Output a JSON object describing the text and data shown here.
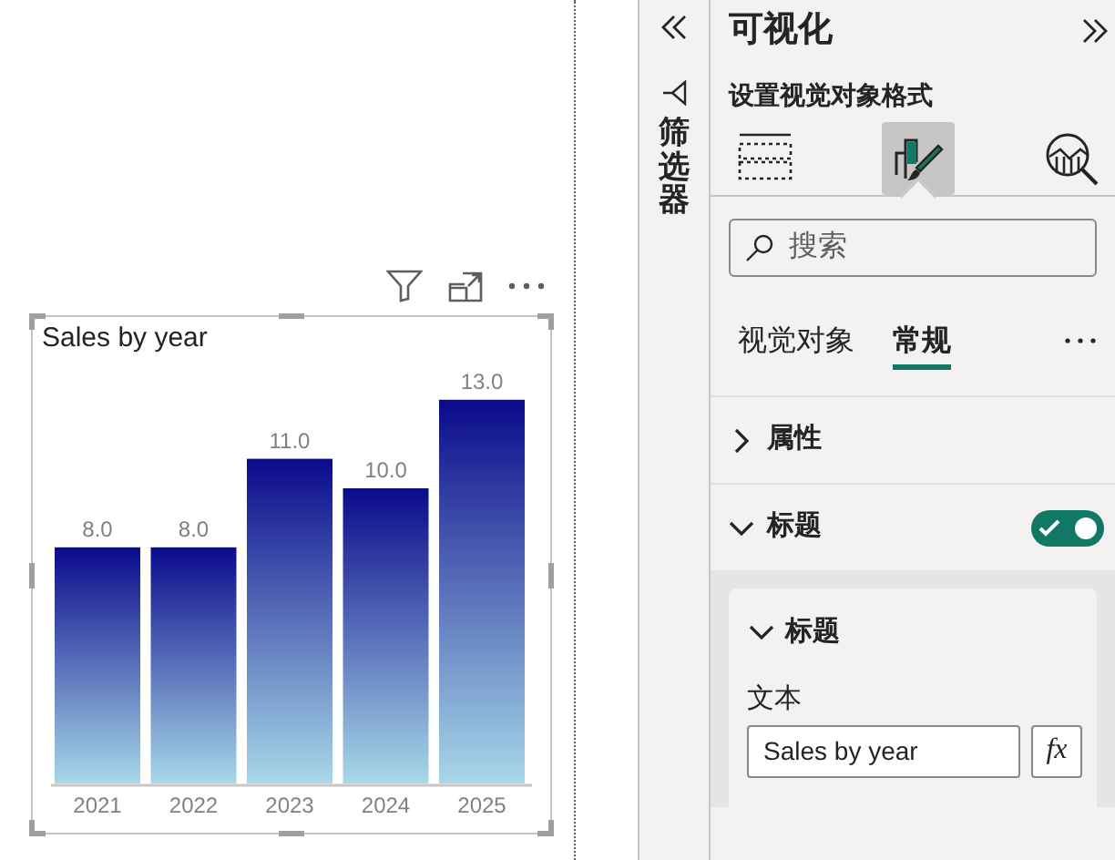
{
  "canvas": {
    "visual": {
      "title": "Sales by year",
      "chart_data": {
        "type": "bar",
        "categories": [
          "2021",
          "2022",
          "2023",
          "2024",
          "2025"
        ],
        "values": [
          8,
          8,
          11,
          10,
          13
        ],
        "value_labels": [
          "8.0",
          "8.0",
          "11.0",
          "10.0",
          "13.0"
        ]
      }
    }
  },
  "filters_pane": {
    "label": "筛选器"
  },
  "visualizations_pane": {
    "title": "可视化",
    "subtitle": "设置视觉对象格式",
    "modes": [
      {
        "kind": "build",
        "selected": false
      },
      {
        "kind": "format",
        "selected": true
      },
      {
        "kind": "analytics",
        "selected": false
      }
    ],
    "search": {
      "placeholder": "搜索"
    },
    "tabs": [
      {
        "label": "视觉对象",
        "selected": false
      },
      {
        "label": "常规",
        "selected": true
      }
    ],
    "sections": [
      {
        "label": "属性",
        "expanded": false
      },
      {
        "label": "标题",
        "expanded": true,
        "on": true
      }
    ],
    "card": {
      "header": {
        "label": "标题",
        "expanded": true
      },
      "field_label": "文本",
      "field_value": "Sales by year",
      "fx": "fx"
    }
  }
}
